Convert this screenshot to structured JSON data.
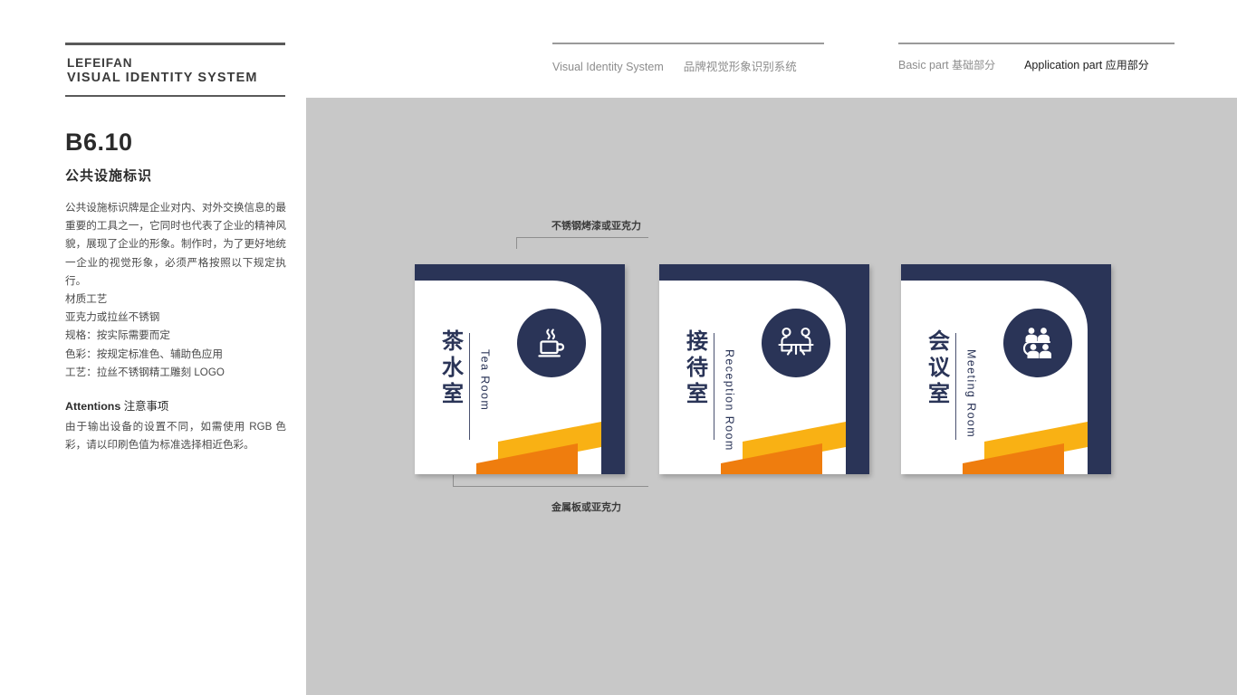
{
  "brand": {
    "line1": "LEFEIFAN",
    "line2": "VISUAL IDENTITY SYSTEM"
  },
  "header": {
    "nav_left": [
      {
        "label": "Visual Identity System",
        "active": false
      },
      {
        "label": "品牌视觉形象识别系统",
        "active": false
      }
    ],
    "nav_right": [
      {
        "en": "Basic part",
        "cn": "基础部分",
        "active": false
      },
      {
        "en": "Application part",
        "cn": "应用部分",
        "active": true
      }
    ]
  },
  "sidebar": {
    "section_code": "B6.10",
    "section_title": "公共设施标识",
    "body": "公共设施标识牌是企业对内、对外交换信息的最重要的工具之一，它同时也代表了企业的精神风貌，展现了企业的形象。制作时，为了更好地统一企业的视觉形象，必须严格按照以下规定执行。",
    "spec_lines": [
      "材质工艺",
      "亚克力或拉丝不锈钢",
      "规格：按实际需要而定",
      "色彩：按规定标准色、辅助色应用",
      "工艺：拉丝不锈钢精工雕刻 LOGO"
    ],
    "attentions_en": "Attentions",
    "attentions_cn": "注意事项",
    "attentions_body": "由于输出设备的设置不同，如需使用 RGB 色彩，请以印刷色值为标准选择相近色彩。"
  },
  "callouts": {
    "top": "不锈钢烤漆或亚克力",
    "bottom": "金属板或亚克力"
  },
  "signs": [
    {
      "cn": "茶水室",
      "en": "Tea Room",
      "icon": "teacup-icon"
    },
    {
      "cn": "接待室",
      "en": "Reception Room",
      "icon": "two-people-table-icon"
    },
    {
      "cn": "会议室",
      "en": "Meeting Room",
      "icon": "meeting-group-icon"
    }
  ],
  "colors": {
    "navy": "#2A3457",
    "orange_light": "#F9B114",
    "orange_dark": "#EF7D0E",
    "stage_gray": "#C8C8C8",
    "white": "#FFFFFF"
  }
}
